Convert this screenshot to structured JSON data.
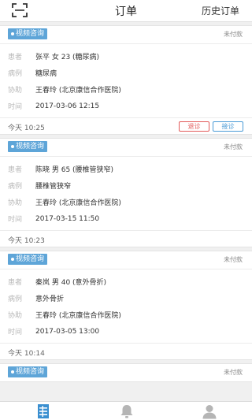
{
  "header": {
    "title": "订单",
    "history_label": "历史订单"
  },
  "labels": {
    "patient": "患者",
    "case": "病例",
    "assist": "协助",
    "time": "时间"
  },
  "orders": [
    {
      "type": "视频咨询",
      "pay_status": "未付款",
      "patient": "张平 女 23 (糖尿病)",
      "case": "糖尿病",
      "assist": "王春玲 (北京康信合作医院)",
      "time": "2017-03-06 12:15",
      "created": "今天 10:25",
      "reject_label": "退诊",
      "accept_label": "接诊"
    },
    {
      "type": "视频咨询",
      "pay_status": "未付款",
      "patient": "陈晓 男 65 (腰椎管狭窄)",
      "case": "腰椎管狭窄",
      "assist": "王春玲 (北京康信合作医院)",
      "time": "2017-03-15 11:50",
      "created": "今天 10:23"
    },
    {
      "type": "视频咨询",
      "pay_status": "未付款",
      "patient": "秦岚 男 40 (意外骨折)",
      "case": "意外骨折",
      "assist": "王春玲 (北京康信合作医院)",
      "time": "2017-03-05 13:00",
      "created": "今天 10:14"
    },
    {
      "type": "视频咨询",
      "pay_status": "未付款"
    }
  ],
  "tabbar": {
    "items": [
      {
        "icon": "list-icon",
        "active": true
      },
      {
        "icon": "bell-icon",
        "active": false
      },
      {
        "icon": "user-icon",
        "active": false
      }
    ]
  },
  "colors": {
    "accent": "#5ea5d8",
    "reject": "#e25a5a",
    "accept": "#4a9bd6",
    "inactive_icon": "#b5b5b5"
  }
}
